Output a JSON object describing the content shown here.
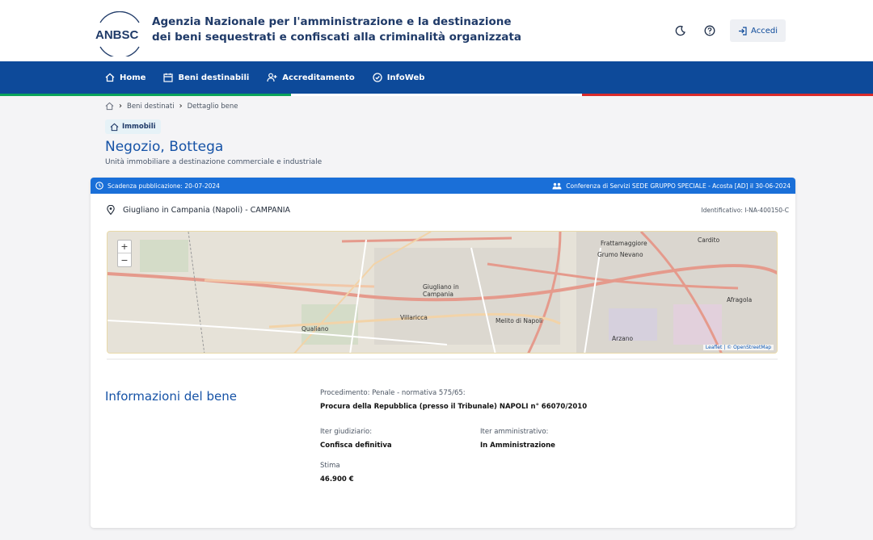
{
  "header": {
    "logo_text": "ANBSC",
    "title_line1": "Agenzia Nazionale per l'amministrazione e la destinazione",
    "title_line2": "dei beni sequestrati e confiscati alla criminalità organizzata",
    "login_label": "Accedi"
  },
  "nav": {
    "items": [
      {
        "label": "Home",
        "icon": "home-icon"
      },
      {
        "label": "Beni destinabili",
        "icon": "calendar-icon"
      },
      {
        "label": "Accreditamento",
        "icon": "user-plus-icon"
      },
      {
        "label": "InfoWeb",
        "icon": "info-icon"
      }
    ]
  },
  "breadcrumb": {
    "items": [
      "Beni destinati",
      "Dettaglio bene"
    ]
  },
  "page": {
    "category": "Immobili",
    "title": "Negozio, Bottega",
    "subtitle": "Unità immobiliare a destinazione commerciale e industriale"
  },
  "card": {
    "header_left": "Scadenza pubblicazione: 20-07-2024",
    "header_right": "Conferenza di Servizi SEDE GRUPPO SPECIALE - Acosta [AD] il 30-06-2024",
    "location": "Giugliano in Campania (Napoli) - CAMPANIA",
    "identifier": "Identificativo: I-NA-400150-C",
    "map": {
      "attribution": "Leaflet | © OpenStreetMap",
      "labels": [
        "Frattamaggiore",
        "Cardito",
        "Grumo Nevano",
        "Giugliano in Campania",
        "Villaricca",
        "Melito di Napoli",
        "Qualiano",
        "Arzano",
        "Afragola"
      ]
    }
  },
  "info": {
    "title": "Informazioni del bene",
    "procedimento_label": "Procedimento: Penale - normativa 575/65:",
    "procedimento_value": "Procura della Repubblica (presso il Tribunale) NAPOLI n° 66070/2010",
    "iter_giudiziario_label": "Iter giudiziario:",
    "iter_giudiziario_value": "Confisca definitiva",
    "iter_amministrativo_label": "Iter amministrativo:",
    "iter_amministrativo_value": "In Amministrazione",
    "stima_label": "Stima",
    "stima_value": "46.900 €"
  }
}
